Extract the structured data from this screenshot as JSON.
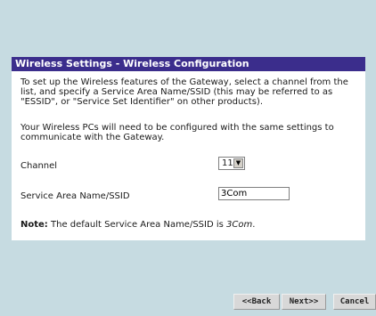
{
  "panel": {
    "title": "Wireless Settings - Wireless Configuration",
    "intro_text": "To set up the Wireless features of the Gateway, select a channel from the list, and specify a Service Area Name/SSID (this may be referred to as \"ESSID\", or \"Service Set Identifier\" on other products).",
    "intro_text2": "Your Wireless PCs will need to be configured with the same settings to communicate with the Gateway."
  },
  "channel": {
    "label": "Channel",
    "value": "11"
  },
  "ssid": {
    "label": "Service Area Name/SSID",
    "value": "3Com"
  },
  "note": {
    "prefix": "Note:",
    "text": " The default Service Area Name/SSID is ",
    "default_value": "3Com",
    "suffix": "."
  },
  "buttons": {
    "back": "<<Back",
    "next": "Next>>",
    "cancel": "Cancel"
  },
  "colors": {
    "background": "#c6dbe1",
    "title_bar": "#3b2d8c",
    "panel": "#ffffff"
  },
  "icons": {
    "dropdown": "chevron-down-icon"
  }
}
